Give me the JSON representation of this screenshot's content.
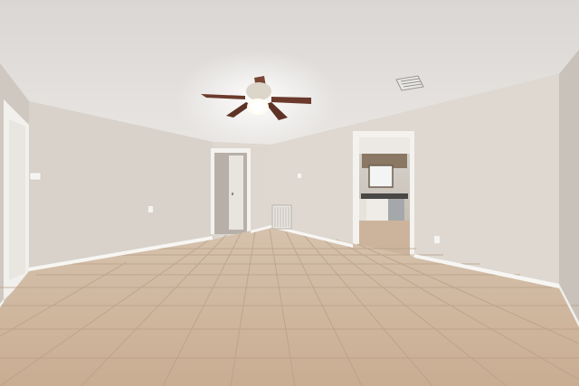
{
  "scene": {
    "kind": "photo",
    "subject": "empty-room-interior",
    "features": [
      "textured-ceiling",
      "ceiling-fan-with-light",
      "hvac-vent",
      "interior-doors",
      "kitchen-view",
      "beige-walls",
      "white-baseboards",
      "tile-floor"
    ],
    "colors": {
      "ceiling": "#e2dfdc",
      "wall_left": "#d7d1ca",
      "wall_back": "#ded8d1",
      "wall_right": "#dcd6cf",
      "floor": "#cdb59c",
      "grout": "#b59e86",
      "trim": "#f7f6f3",
      "fan_blade": "#6b3a2c",
      "fan_body": "#d9d2c7",
      "light": "#fffdf4"
    }
  }
}
